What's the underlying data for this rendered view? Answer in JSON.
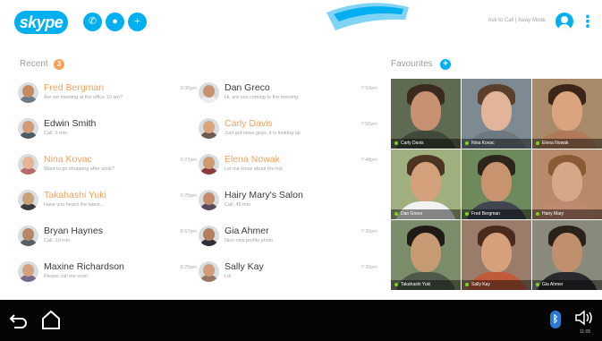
{
  "header": {
    "logo": "skype",
    "status_text": "Ask to Call | Away Mode",
    "buttons": [
      {
        "icon": "phone-icon",
        "glyph": "✆"
      },
      {
        "icon": "chat-icon",
        "glyph": "●"
      },
      {
        "icon": "add-contact-icon",
        "glyph": "+"
      }
    ],
    "accent": "#00aff0"
  },
  "recent": {
    "title": "Recent",
    "badge": "3",
    "badge_color": "#f6a15b",
    "left": [
      {
        "name": "Fred Bergman",
        "msg": "Are we meeting at the office 10 am?",
        "time": "9:30pm",
        "unread": true,
        "skin": "#c48a63",
        "shirt": "#6c7a86"
      },
      {
        "name": "Edwin Smith",
        "msg": "Call, 5 min",
        "time": "",
        "unread": false,
        "skin": "#d09a74",
        "shirt": "#4c5a66"
      },
      {
        "name": "Nina Kovac",
        "msg": "Want to go shopping after work?",
        "time": "9:27pm",
        "unread": true,
        "skin": "#e5b596",
        "shirt": "#b86a6a"
      },
      {
        "name": "Takahashi Yuki",
        "msg": "Have you heard the latest...",
        "time": "9:25pm",
        "unread": true,
        "skin": "#caa076",
        "shirt": "#3b3b3b"
      },
      {
        "name": "Bryan Haynes",
        "msg": "Call, 10 min",
        "time": "8:57pm",
        "unread": false,
        "skin": "#b98566",
        "shirt": "#555f68"
      },
      {
        "name": "Maxine Richardson",
        "msg": "Please call me soon",
        "time": "8:25pm",
        "unread": false,
        "skin": "#d6a27e",
        "shirt": "#7a6a8a"
      }
    ],
    "right": [
      {
        "name": "Dan Greco",
        "msg": "Hi, are you coming to the meeting",
        "time": "7:53pm",
        "unread": false,
        "skin": "#c7936e",
        "shirt": "#eeeeee"
      },
      {
        "name": "Carly Davis",
        "msg": "Just got news guys, it is looking up",
        "time": "7:50pm",
        "unread": true,
        "skin": "#d8a47c",
        "shirt": "#6f5a4a"
      },
      {
        "name": "Elena Nowak",
        "msg": "Let me know about the trip",
        "time": "7:48pm",
        "unread": true,
        "skin": "#cf9a72",
        "shirt": "#8a3b3b"
      },
      {
        "name": "Hairy Mary's Salon",
        "msg": "Call, 45 min",
        "time": "",
        "unread": false,
        "skin": "#c38c66",
        "shirt": "#5a4a5a"
      },
      {
        "name": "Gia Ahmer",
        "msg": "Nice new profile photo",
        "time": "7:30pm",
        "unread": false,
        "skin": "#b57e5c",
        "shirt": "#2e2e36"
      },
      {
        "name": "Sally Kay",
        "msg": "Lol",
        "time": "7:30pm",
        "unread": false,
        "skin": "#d29c77",
        "shirt": "#9a7462"
      }
    ]
  },
  "favourites": {
    "title": "Favourites",
    "items": [
      {
        "name": "Carly Davis",
        "bg": "#5e6b52",
        "skin": "#c89272",
        "hair": "#3b2a20",
        "shirt": "#414a3a"
      },
      {
        "name": "Nina Kovac",
        "bg": "#7d8a92",
        "skin": "#e2b49a",
        "hair": "#5a3f2c",
        "shirt": "#6d7880"
      },
      {
        "name": "Elena Nowak",
        "bg": "#a88a6a",
        "skin": "#d9a47e",
        "hair": "#3d2618",
        "shirt": "#b07a5a"
      },
      {
        "name": "Dan Greco",
        "bg": "#9fb07e",
        "skin": "#d3a27c",
        "hair": "#4c3322",
        "shirt": "#f2f2f2"
      },
      {
        "name": "Fred Bergman",
        "bg": "#6e8a5c",
        "skin": "#c89470",
        "hair": "#2d241c",
        "shirt": "#3f4650"
      },
      {
        "name": "Hairy Mary",
        "bg": "#b98a6a",
        "skin": "#d6a888",
        "hair": "#8a5a34",
        "shirt": "#c08a70"
      },
      {
        "name": "Takahashi Yuki",
        "bg": "#7b8c6a",
        "skin": "#c69a72",
        "hair": "#1f1a16",
        "shirt": "#4d5a4a"
      },
      {
        "name": "Sally Kay",
        "bg": "#9a7c6a",
        "skin": "#d6a07c",
        "hair": "#4a2a1c",
        "shirt": "#c05a3a"
      },
      {
        "name": "Gia Ahmer",
        "bg": "#8a8a7c",
        "skin": "#c0906e",
        "hair": "#2b211b",
        "shirt": "#2a2a2e"
      }
    ]
  },
  "navbar": {
    "back_icon": "back-arrow-icon",
    "home_icon": "home-icon",
    "bluetooth_icon": "bluetooth-icon",
    "volume_icon": "volume-icon",
    "clock": "11:05"
  }
}
